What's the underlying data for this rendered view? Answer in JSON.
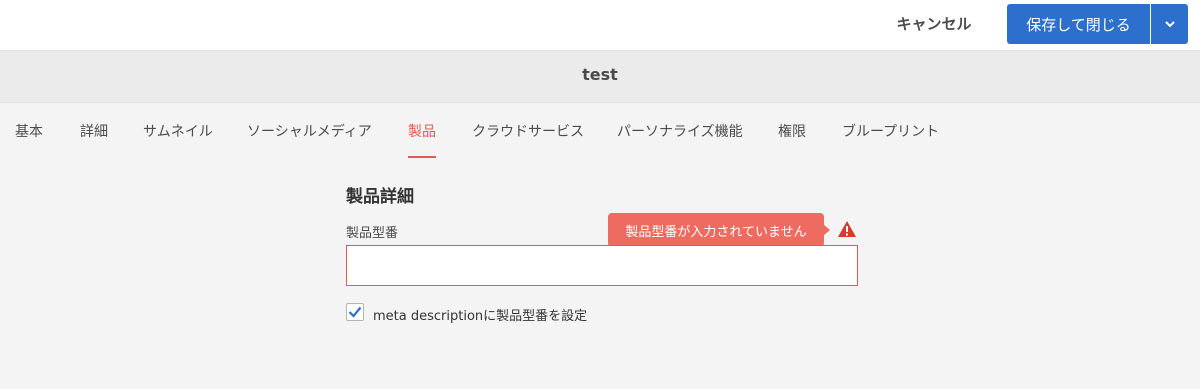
{
  "header": {
    "cancel_label": "キャンセル",
    "save_close_label": "保存して閉じる"
  },
  "page": {
    "title": "test"
  },
  "tabs": [
    {
      "label": "基本",
      "active": false
    },
    {
      "label": "詳細",
      "active": false
    },
    {
      "label": "サムネイル",
      "active": false
    },
    {
      "label": "ソーシャルメディア",
      "active": false
    },
    {
      "label": "製品",
      "active": true
    },
    {
      "label": "クラウドサービス",
      "active": false
    },
    {
      "label": "パーソナライズ機能",
      "active": false
    },
    {
      "label": "権限",
      "active": false
    },
    {
      "label": "ブループリント",
      "active": false
    }
  ],
  "form": {
    "section_title": "製品詳細",
    "model_number_label": "製品型番",
    "model_number_value": "",
    "error_message": "製品型番が入力されていません",
    "checkbox_label": "meta descriptionに製品型番を設定",
    "checkbox_checked": true
  },
  "colors": {
    "primary": "#2d6fcc",
    "error": "#e05a4f",
    "tooltip": "#ee6b61",
    "background": "#f4f4f4"
  },
  "icons": {
    "dropdown": "chevron-down-icon",
    "alert": "alert-triangle-icon",
    "check": "checkmark-icon"
  }
}
